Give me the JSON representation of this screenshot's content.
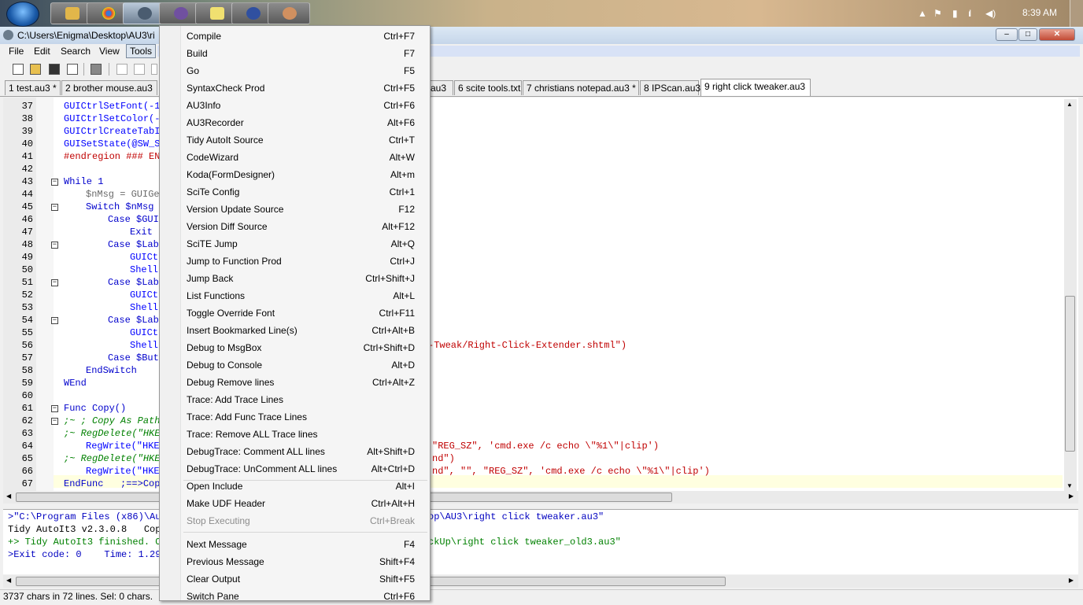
{
  "taskbar": {
    "clock": "8:39 AM"
  },
  "window": {
    "title": "C:\\Users\\Enigma\\Desktop\\AU3\\ri",
    "controls": [
      "‒",
      "□",
      "✕"
    ]
  },
  "menubar": [
    "File",
    "Edit",
    "Search",
    "View",
    "Tools"
  ],
  "tabs": [
    "1 test.au3 *",
    "2 brother mouse.au3",
    "au3",
    "6 scite tools.txt",
    "7 christians notepad.au3 *",
    "8 IPScan.au3",
    "9 right click tweaker.au3"
  ],
  "editor": {
    "line_numbers": [
      "37",
      "38",
      "39",
      "40",
      "41",
      "42",
      "43",
      "44",
      "45",
      "46",
      "47",
      "48",
      "49",
      "50",
      "51",
      "52",
      "53",
      "54",
      "55",
      "56",
      "57",
      "58",
      "59",
      "60",
      "61",
      "62",
      "63",
      "64",
      "65",
      "66",
      "67"
    ],
    "lines": [
      {
        "t": "GUICtrlSetFont(-1",
        "c": "fn",
        "i": 0
      },
      {
        "t": "GUICtrlSetColor(-",
        "c": "fn",
        "i": 0
      },
      {
        "t": "GUICtrlCreateTabI",
        "c": "fn",
        "i": 0
      },
      {
        "t": "GUISetState(@SW_S",
        "c": "fn",
        "i": 0
      },
      {
        "t": "#endregion ### EN",
        "c": "region",
        "i": 0
      },
      {
        "t": "",
        "c": "",
        "i": 0
      },
      {
        "t": "While 1",
        "c": "kw",
        "i": 0
      },
      {
        "t": "$nMsg = GUIGe",
        "c": "var",
        "i": 4
      },
      {
        "t": "Switch $nMsg",
        "c": "kw",
        "i": 4
      },
      {
        "t": "Case $GUI",
        "c": "kw",
        "i": 8
      },
      {
        "t": "Exit",
        "c": "kw",
        "i": 12
      },
      {
        "t": "Case $Lab",
        "c": "kw",
        "i": 8
      },
      {
        "t": "GUICt",
        "c": "fn",
        "i": 12
      },
      {
        "t": "Shell",
        "c": "fn",
        "i": 12
      },
      {
        "t": "Case $Lab",
        "c": "kw",
        "i": 8
      },
      {
        "t": "GUICt",
        "c": "fn",
        "i": 12
      },
      {
        "t": "Shell",
        "c": "fn",
        "i": 12
      },
      {
        "t": "Case $Lab",
        "c": "kw",
        "i": 8
      },
      {
        "t": "GUICt",
        "c": "fn",
        "i": 12
      },
      {
        "t": "Shell",
        "c": "fn",
        "i": 12
      },
      {
        "t": "Case $But",
        "c": "kw",
        "i": 8
      },
      {
        "t": "EndSwitch",
        "c": "kw",
        "i": 4
      },
      {
        "t": "WEnd",
        "c": "kw",
        "i": 0
      },
      {
        "t": "",
        "c": "",
        "i": 0
      },
      {
        "t": "Func Copy()",
        "c": "kw",
        "i": 0
      },
      {
        "t": ";~ ; Copy As Path",
        "c": "cmt",
        "i": 0
      },
      {
        "t": ";~ RegDelete(\"HKE",
        "c": "cmt",
        "i": 0
      },
      {
        "t": "RegWrite(\"HKE",
        "c": "fn",
        "i": 4
      },
      {
        "t": ";~ RegDelete(\"HKE",
        "c": "cmt",
        "i": 0
      },
      {
        "t": "RegWrite(\"HKE",
        "c": "fn",
        "i": 4
      },
      {
        "t": "EndFunc   ;==>Cop",
        "c": "kw",
        "i": 0
      }
    ],
    "right_fragments": [
      {
        "line": "56",
        "text": "-Tweak/Right-Click-Extender.shtml\")"
      },
      {
        "line": "64",
        "text": "\"REG_SZ\", 'cmd.exe /c echo \\\"%1\\\"|clip')"
      },
      {
        "line": "65",
        "text": "nd\")"
      },
      {
        "line": "66",
        "text": "nd\", \"\", \"REG_SZ\", 'cmd.exe /c echo \\\"%1\\\"|clip')"
      }
    ]
  },
  "output": {
    "lines": [
      {
        "left": ">\"C:\\Program Files (x86)\\Aut",
        "right": "op\\AU3\\right click tweaker.au3\"",
        "color": "blue"
      },
      {
        "left": "Tidy AutoIt3 v2.3.0.8   Copy",
        "right": "",
        "color": "black"
      },
      {
        "left": "+> Tidy AutoIt3 finished. Ol",
        "right": "ckUp\\right click tweaker_old3.au3\"",
        "color": "green"
      },
      {
        "left": ">Exit code: 0    Time: 1.29",
        "right": "",
        "color": "blue"
      }
    ]
  },
  "status": "3737 chars in 72 lines. Sel: 0 chars.",
  "tools_menu": {
    "items": [
      {
        "label": "Compile",
        "shortcut": "Ctrl+F7"
      },
      {
        "label": "Build",
        "shortcut": "F7"
      },
      {
        "label": "Go",
        "shortcut": "F5"
      },
      {
        "label": "SyntaxCheck Prod",
        "shortcut": "Ctrl+F5"
      },
      {
        "label": "AU3Info",
        "shortcut": "Ctrl+F6"
      },
      {
        "label": "AU3Recorder",
        "shortcut": "Alt+F6"
      },
      {
        "label": "Tidy AutoIt Source",
        "shortcut": "Ctrl+T"
      },
      {
        "label": "CodeWizard",
        "shortcut": "Alt+W"
      },
      {
        "label": "Koda(FormDesigner)",
        "shortcut": "Alt+m"
      },
      {
        "label": "SciTe Config",
        "shortcut": "Ctrl+1"
      },
      {
        "label": "Version Update Source",
        "shortcut": "F12"
      },
      {
        "label": "Version Diff Source",
        "shortcut": "Alt+F12"
      },
      {
        "label": "SciTE Jump",
        "shortcut": "Alt+Q"
      },
      {
        "label": "Jump to Function Prod",
        "shortcut": "Ctrl+J"
      },
      {
        "label": "Jump Back",
        "shortcut": "Ctrl+Shift+J"
      },
      {
        "label": "List Functions",
        "shortcut": "Alt+L"
      },
      {
        "label": "Toggle Override Font",
        "shortcut": "Ctrl+F11"
      },
      {
        "label": "Insert Bookmarked Line(s)",
        "shortcut": "Ctrl+Alt+B"
      },
      {
        "label": "Debug to MsgBox",
        "shortcut": "Ctrl+Shift+D"
      },
      {
        "label": "Debug to Console",
        "shortcut": "Alt+D"
      },
      {
        "label": "Debug Remove lines",
        "shortcut": "Ctrl+Alt+Z"
      },
      {
        "label": "Trace: Add Trace Lines",
        "shortcut": ""
      },
      {
        "label": "Trace: Add Func Trace Lines",
        "shortcut": ""
      },
      {
        "label": "Trace: Remove ALL Trace lines",
        "shortcut": ""
      },
      {
        "label": "DebugTrace: Comment ALL lines",
        "shortcut": "Alt+Shift+D"
      },
      {
        "label": "DebugTrace: UnComment ALL lines",
        "shortcut": "Alt+Ctrl+D"
      },
      {
        "label": "Open Include",
        "shortcut": "Alt+I"
      },
      {
        "label": "Make UDF Header",
        "shortcut": "Ctrl+Alt+H"
      },
      {
        "label": "Stop Executing",
        "shortcut": "Ctrl+Break",
        "disabled": true
      },
      {
        "label": "Next Message",
        "shortcut": "F4"
      },
      {
        "label": "Previous Message",
        "shortcut": "Shift+F4"
      },
      {
        "label": "Clear Output",
        "shortcut": "Shift+F5"
      },
      {
        "label": "Switch Pane",
        "shortcut": "Ctrl+F6"
      }
    ]
  }
}
